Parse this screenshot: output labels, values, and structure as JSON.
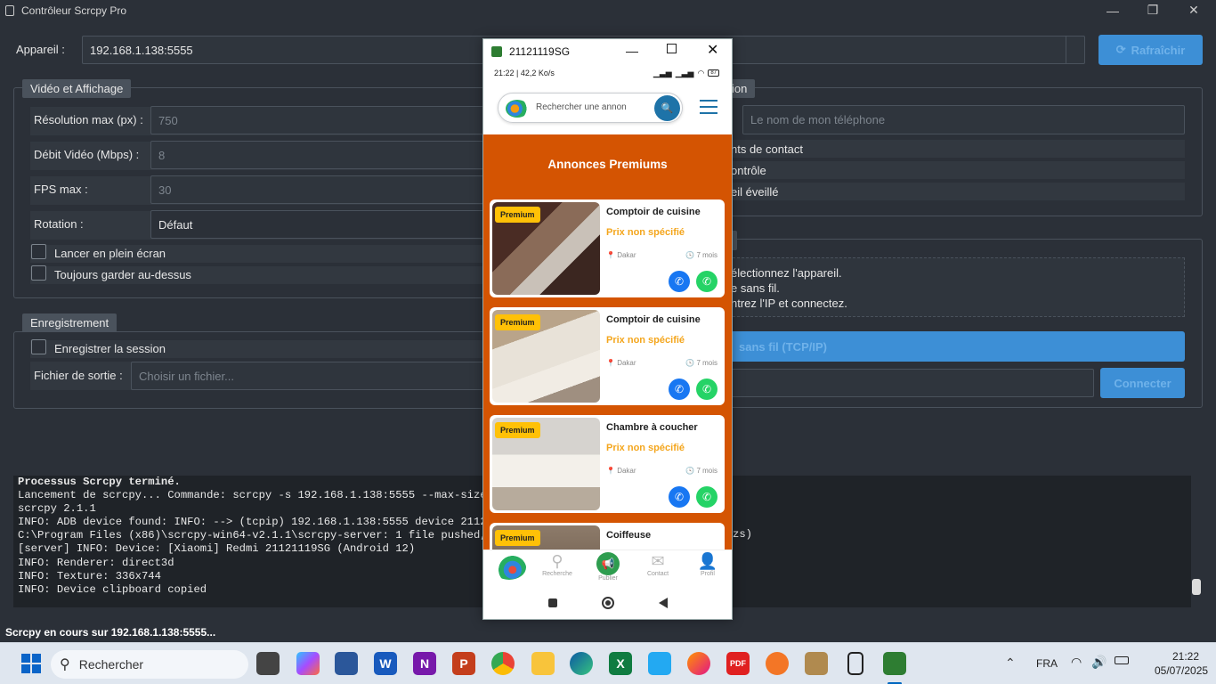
{
  "window": {
    "title": "Contrôleur Scrcpy Pro"
  },
  "device": {
    "label": "Appareil :",
    "value": "192.168.1.138:5555",
    "refresh": "Rafraîchir"
  },
  "video": {
    "title": "Vidéo et Affichage",
    "res_label": "Résolution max (px) :",
    "res_placeholder": "750",
    "bitrate_label": "Débit Vidéo (Mbps) :",
    "bitrate_placeholder": "8",
    "fps_label": "FPS max :",
    "fps_placeholder": "30",
    "rotation_label": "Rotation :",
    "rotation_value": "Défaut",
    "fullscreen": "Lancer en plein écran",
    "ontop": "Toujours garder au-dessus"
  },
  "recording": {
    "title": "Enregistrement",
    "record": "Enregistrer la session",
    "output_label": "Fichier de sortie :",
    "output_placeholder": "Choisir un fichier..."
  },
  "right_options": {
    "title_partial": "ion",
    "name_placeholder": "Le nom de mon téléphone",
    "opt1": "nts de contact",
    "opt2": "ontrôle",
    "opt3": "eil éveillé"
  },
  "wireless": {
    "line1": "électionnez l'appareil.",
    "line2": "e sans fil.",
    "line3": "ntrez l'IP et connectez.",
    "button": "sans fil (TCP/IP)",
    "connect": "Connecter"
  },
  "console": [
    "Processus Scrcpy terminé.",
    "Lancement de scrcpy... Commande: scrcpy -s 192.168.1.138:5555 --max-size 75",
    "scrcpy 2.1.1",
    "INFO: ADB device found: INFO: --> (tcpip) 192.168.1.138:5555 device 2112111",
    "C:\\Program Files (x86)\\scrcpy-win64-v2.1.1\\scrcpy-server: 1 file pushed, 0",
    "[server] INFO: Device: [Xiaomi] Redmi 21121119SG (Android 12)",
    "INFO: Renderer: direct3d",
    "INFO: Texture: 336x744",
    "INFO: Device clipboard copied"
  ],
  "console_right": "zs)",
  "status": "Scrcpy en cours sur 192.168.1.138:5555...",
  "phone": {
    "title": "21121119SG",
    "status_left": "21:22 | 42,2 Ko/s",
    "battery": "87",
    "search_placeholder": "Rechercher une annon",
    "section_title": "Annonces Premiums",
    "badge": "Premium",
    "cards": [
      {
        "title": "Comptoir de cuisine",
        "price": "Prix non spécifié",
        "loc": "Dakar",
        "time": "7 mois"
      },
      {
        "title": "Comptoir de cuisine",
        "price": "Prix non spécifié",
        "loc": "Dakar",
        "time": "7 mois"
      },
      {
        "title": "Chambre à coucher",
        "price": "Prix non spécifié",
        "loc": "Dakar",
        "time": "7 mois"
      },
      {
        "title": "Coiffeuse"
      }
    ],
    "nav": [
      "Recherche",
      "Publier",
      "Contact",
      "Profil"
    ]
  },
  "taskbar": {
    "search": "Rechercher",
    "lang": "FRA",
    "time": "21:22",
    "date": "05/07/2025"
  },
  "colors": {
    "accent": "#3d8fd6",
    "phone_bg": "#d45402",
    "premium": "#ffc107",
    "price": "#f4a61d"
  }
}
